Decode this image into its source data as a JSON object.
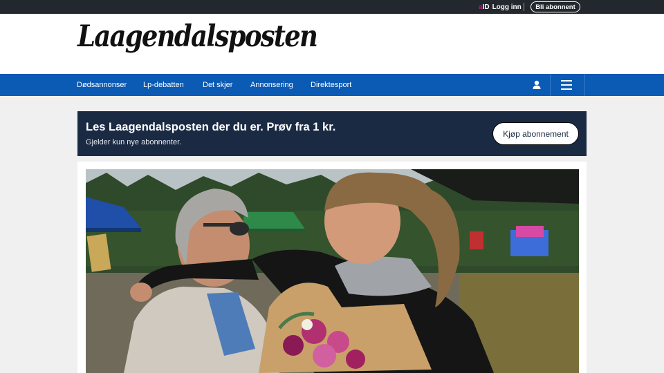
{
  "topbar": {
    "aid_a": "a",
    "aid_id": "ID",
    "login_label": "Logg inn",
    "subscribe_label": "Bli abonnent"
  },
  "masthead": {
    "logo_text": "Laagendalsposten"
  },
  "nav": {
    "items": [
      {
        "label": "Dødsannonser"
      },
      {
        "label": "Lp-debatten"
      },
      {
        "label": "Det skjer"
      },
      {
        "label": "Annonsering"
      },
      {
        "label": "Direktesport"
      }
    ],
    "user_icon": "user-icon",
    "menu_icon": "hamburger-menu-icon"
  },
  "promo": {
    "headline": "Les Laagendalsposten der du er. Prøv fra 1 kr.",
    "subtext": "Gjelder kun nye abonnenter.",
    "cta_label": "Kjøp abonnement"
  },
  "colors": {
    "topbar_bg": "#22282d",
    "nav_bg": "#0b5bb5",
    "promo_bg": "#1b2a43",
    "aid_accent": "#e3007d"
  }
}
